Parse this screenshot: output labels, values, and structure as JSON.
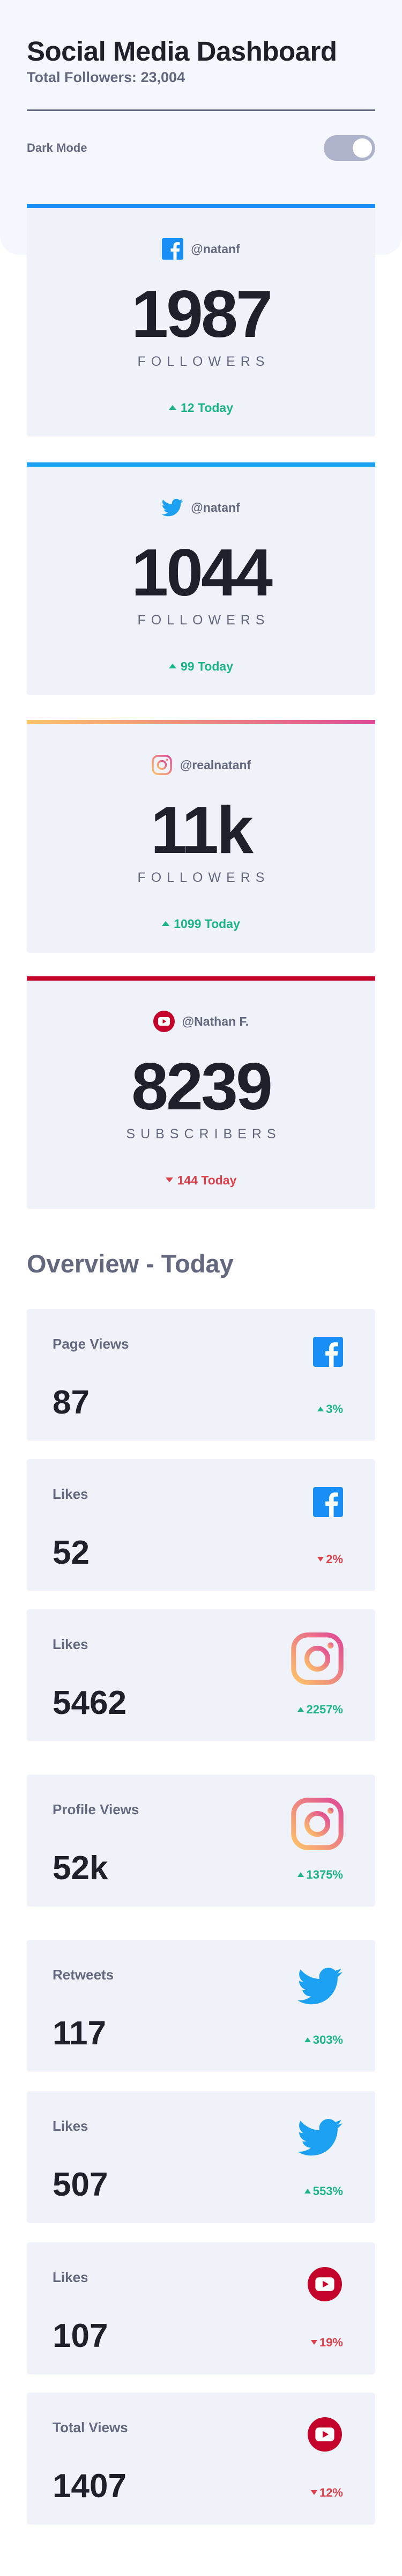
{
  "header": {
    "title": "Social Media Dashboard",
    "subtitle": "Total Followers: 23,004",
    "dark_mode_label": "Dark Mode",
    "dark_mode_on": false
  },
  "colors": {
    "facebook": "#198ff5",
    "twitter": "#1ca0f2",
    "instagram_from": "#fdc468",
    "instagram_to": "#df4996",
    "youtube": "#c4032b",
    "up": "#1db489",
    "down": "#dc414c"
  },
  "followers": [
    {
      "platform": "facebook",
      "icon": "facebook-icon",
      "handle": "@natanf",
      "count": "1987",
      "unit": "FOLLOWERS",
      "change": "12 Today",
      "direction": "up"
    },
    {
      "platform": "twitter",
      "icon": "twitter-icon",
      "handle": "@natanf",
      "count": "1044",
      "unit": "FOLLOWERS",
      "change": "99 Today",
      "direction": "up"
    },
    {
      "platform": "instagram",
      "icon": "instagram-icon",
      "handle": "@realnatanf",
      "count": "11k",
      "unit": "FOLLOWERS",
      "change": "1099 Today",
      "direction": "up"
    },
    {
      "platform": "youtube",
      "icon": "youtube-icon",
      "handle": "@Nathan F.",
      "count": "8239",
      "unit": "SUBSCRIBERS",
      "change": "144 Today",
      "direction": "down"
    }
  ],
  "overview": {
    "title": "Overview - Today",
    "items": [
      {
        "metric": "Page Views",
        "platform": "facebook",
        "icon": "facebook-icon",
        "value": "87",
        "pct": "3%",
        "direction": "up"
      },
      {
        "metric": "Likes",
        "platform": "facebook",
        "icon": "facebook-icon",
        "value": "52",
        "pct": "2%",
        "direction": "down"
      },
      {
        "metric": "Likes",
        "platform": "instagram",
        "icon": "instagram-icon",
        "value": "5462",
        "pct": "2257%",
        "direction": "up"
      },
      {
        "metric": "Profile Views",
        "platform": "instagram",
        "icon": "instagram-icon",
        "value": "52k",
        "pct": "1375%",
        "direction": "up"
      },
      {
        "metric": "Retweets",
        "platform": "twitter",
        "icon": "twitter-icon",
        "value": "117",
        "pct": "303%",
        "direction": "up"
      },
      {
        "metric": "Likes",
        "platform": "twitter",
        "icon": "twitter-icon",
        "value": "507",
        "pct": "553%",
        "direction": "up"
      },
      {
        "metric": "Likes",
        "platform": "youtube",
        "icon": "youtube-icon",
        "value": "107",
        "pct": "19%",
        "direction": "down"
      },
      {
        "metric": "Total Views",
        "platform": "youtube",
        "icon": "youtube-icon",
        "value": "1407",
        "pct": "12%",
        "direction": "down"
      }
    ]
  }
}
